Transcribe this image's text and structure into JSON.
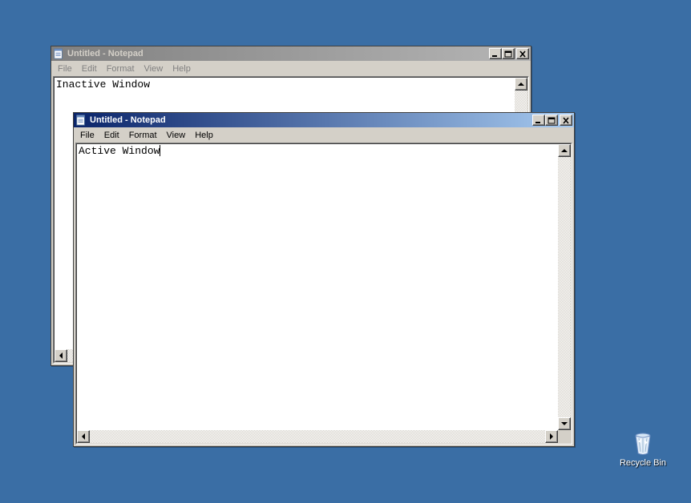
{
  "desktop": {
    "background_color": "#3a6ea5",
    "recycle_bin_label": "Recycle Bin"
  },
  "menus": {
    "file": "File",
    "edit": "Edit",
    "format": "Format",
    "view": "View",
    "help": "Help"
  },
  "inactive_window": {
    "title": "Untitled - Notepad",
    "content": "Inactive Window"
  },
  "active_window": {
    "title": "Untitled - Notepad",
    "content": "Active Window"
  }
}
